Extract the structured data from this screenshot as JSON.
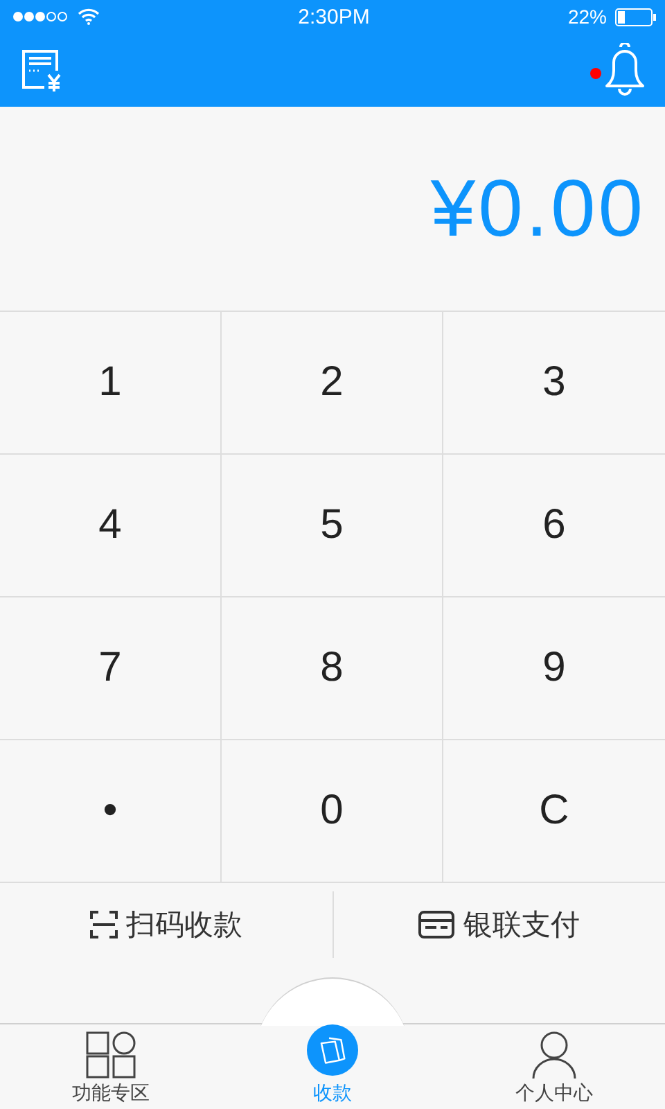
{
  "status_bar": {
    "time": "2:30PM",
    "battery": "22%"
  },
  "header": {
    "has_unread": true
  },
  "amount": "¥0.00",
  "keypad": [
    "1",
    "2",
    "3",
    "4",
    "5",
    "6",
    "7",
    "8",
    "9",
    "•",
    "0",
    "C"
  ],
  "actions": [
    {
      "kind": "scan",
      "label": "扫码收款"
    },
    {
      "kind": "card",
      "label": "银联支付"
    }
  ],
  "tabs": [
    {
      "kind": "grid",
      "label": "功能专区",
      "selected": false
    },
    {
      "kind": "center",
      "label": "收款",
      "selected": true
    },
    {
      "kind": "person",
      "label": "个人中心",
      "selected": false
    }
  ]
}
